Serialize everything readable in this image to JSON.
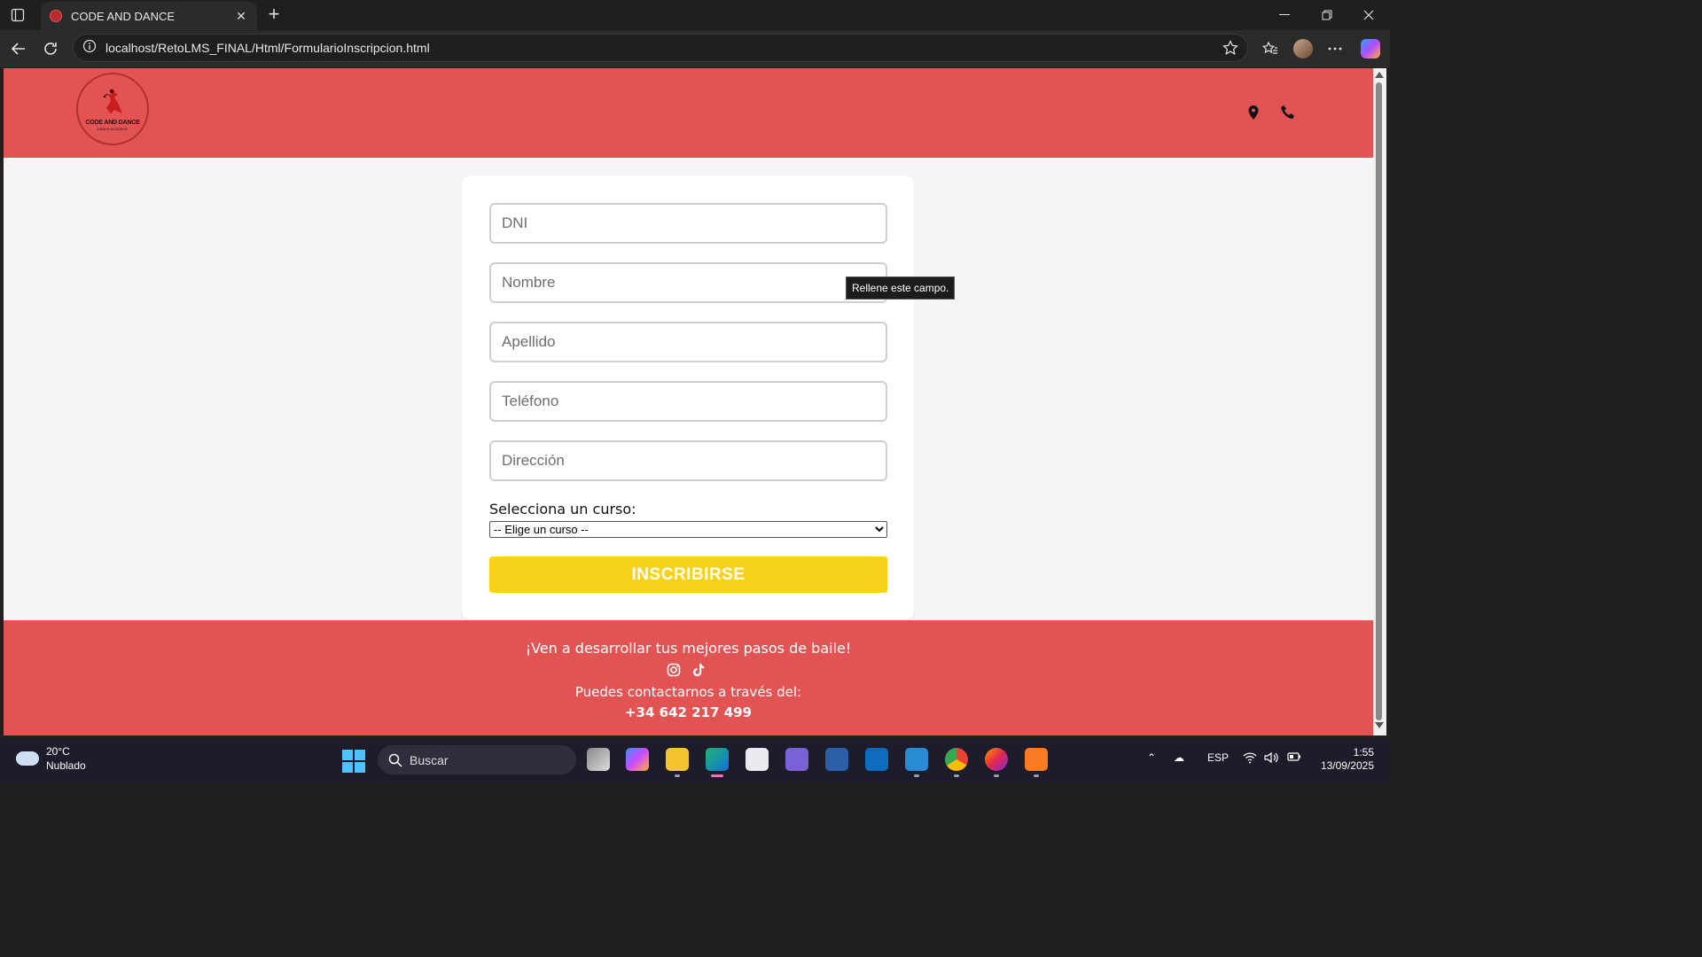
{
  "browser": {
    "tab_title": "CODE AND DANCE",
    "url": "localhost/RetoLMS_FINAL/Html/FormularioInscripcion.html"
  },
  "site": {
    "logo_text": "CODE AND DANCE",
    "logo_subtext": "DANCE ACADEMY",
    "brand_color": "#e25454",
    "accent_color": "#f8d21a"
  },
  "form": {
    "dni_placeholder": "DNI",
    "nombre_placeholder": "Nombre",
    "apellido_placeholder": "Apellido",
    "telefono_placeholder": "Teléfono",
    "direccion_placeholder": "Dirección",
    "select_label": "Selecciona un curso:",
    "select_value": "-- Elige un curso --",
    "submit_label": "INSCRIBIRSE",
    "validation_tooltip": "Rellene este campo."
  },
  "footer": {
    "tagline": "¡Ven a desarrollar tus mejores pasos de baile!",
    "contact_text": "Puedes contactarnos a través del:",
    "phone": "+34 642 217 499"
  },
  "taskbar": {
    "weather_temp": "20°C",
    "weather_desc": "Nublado",
    "search_label": "Buscar",
    "language": "ESP",
    "time": "1:55",
    "date": "13/09/2025"
  }
}
